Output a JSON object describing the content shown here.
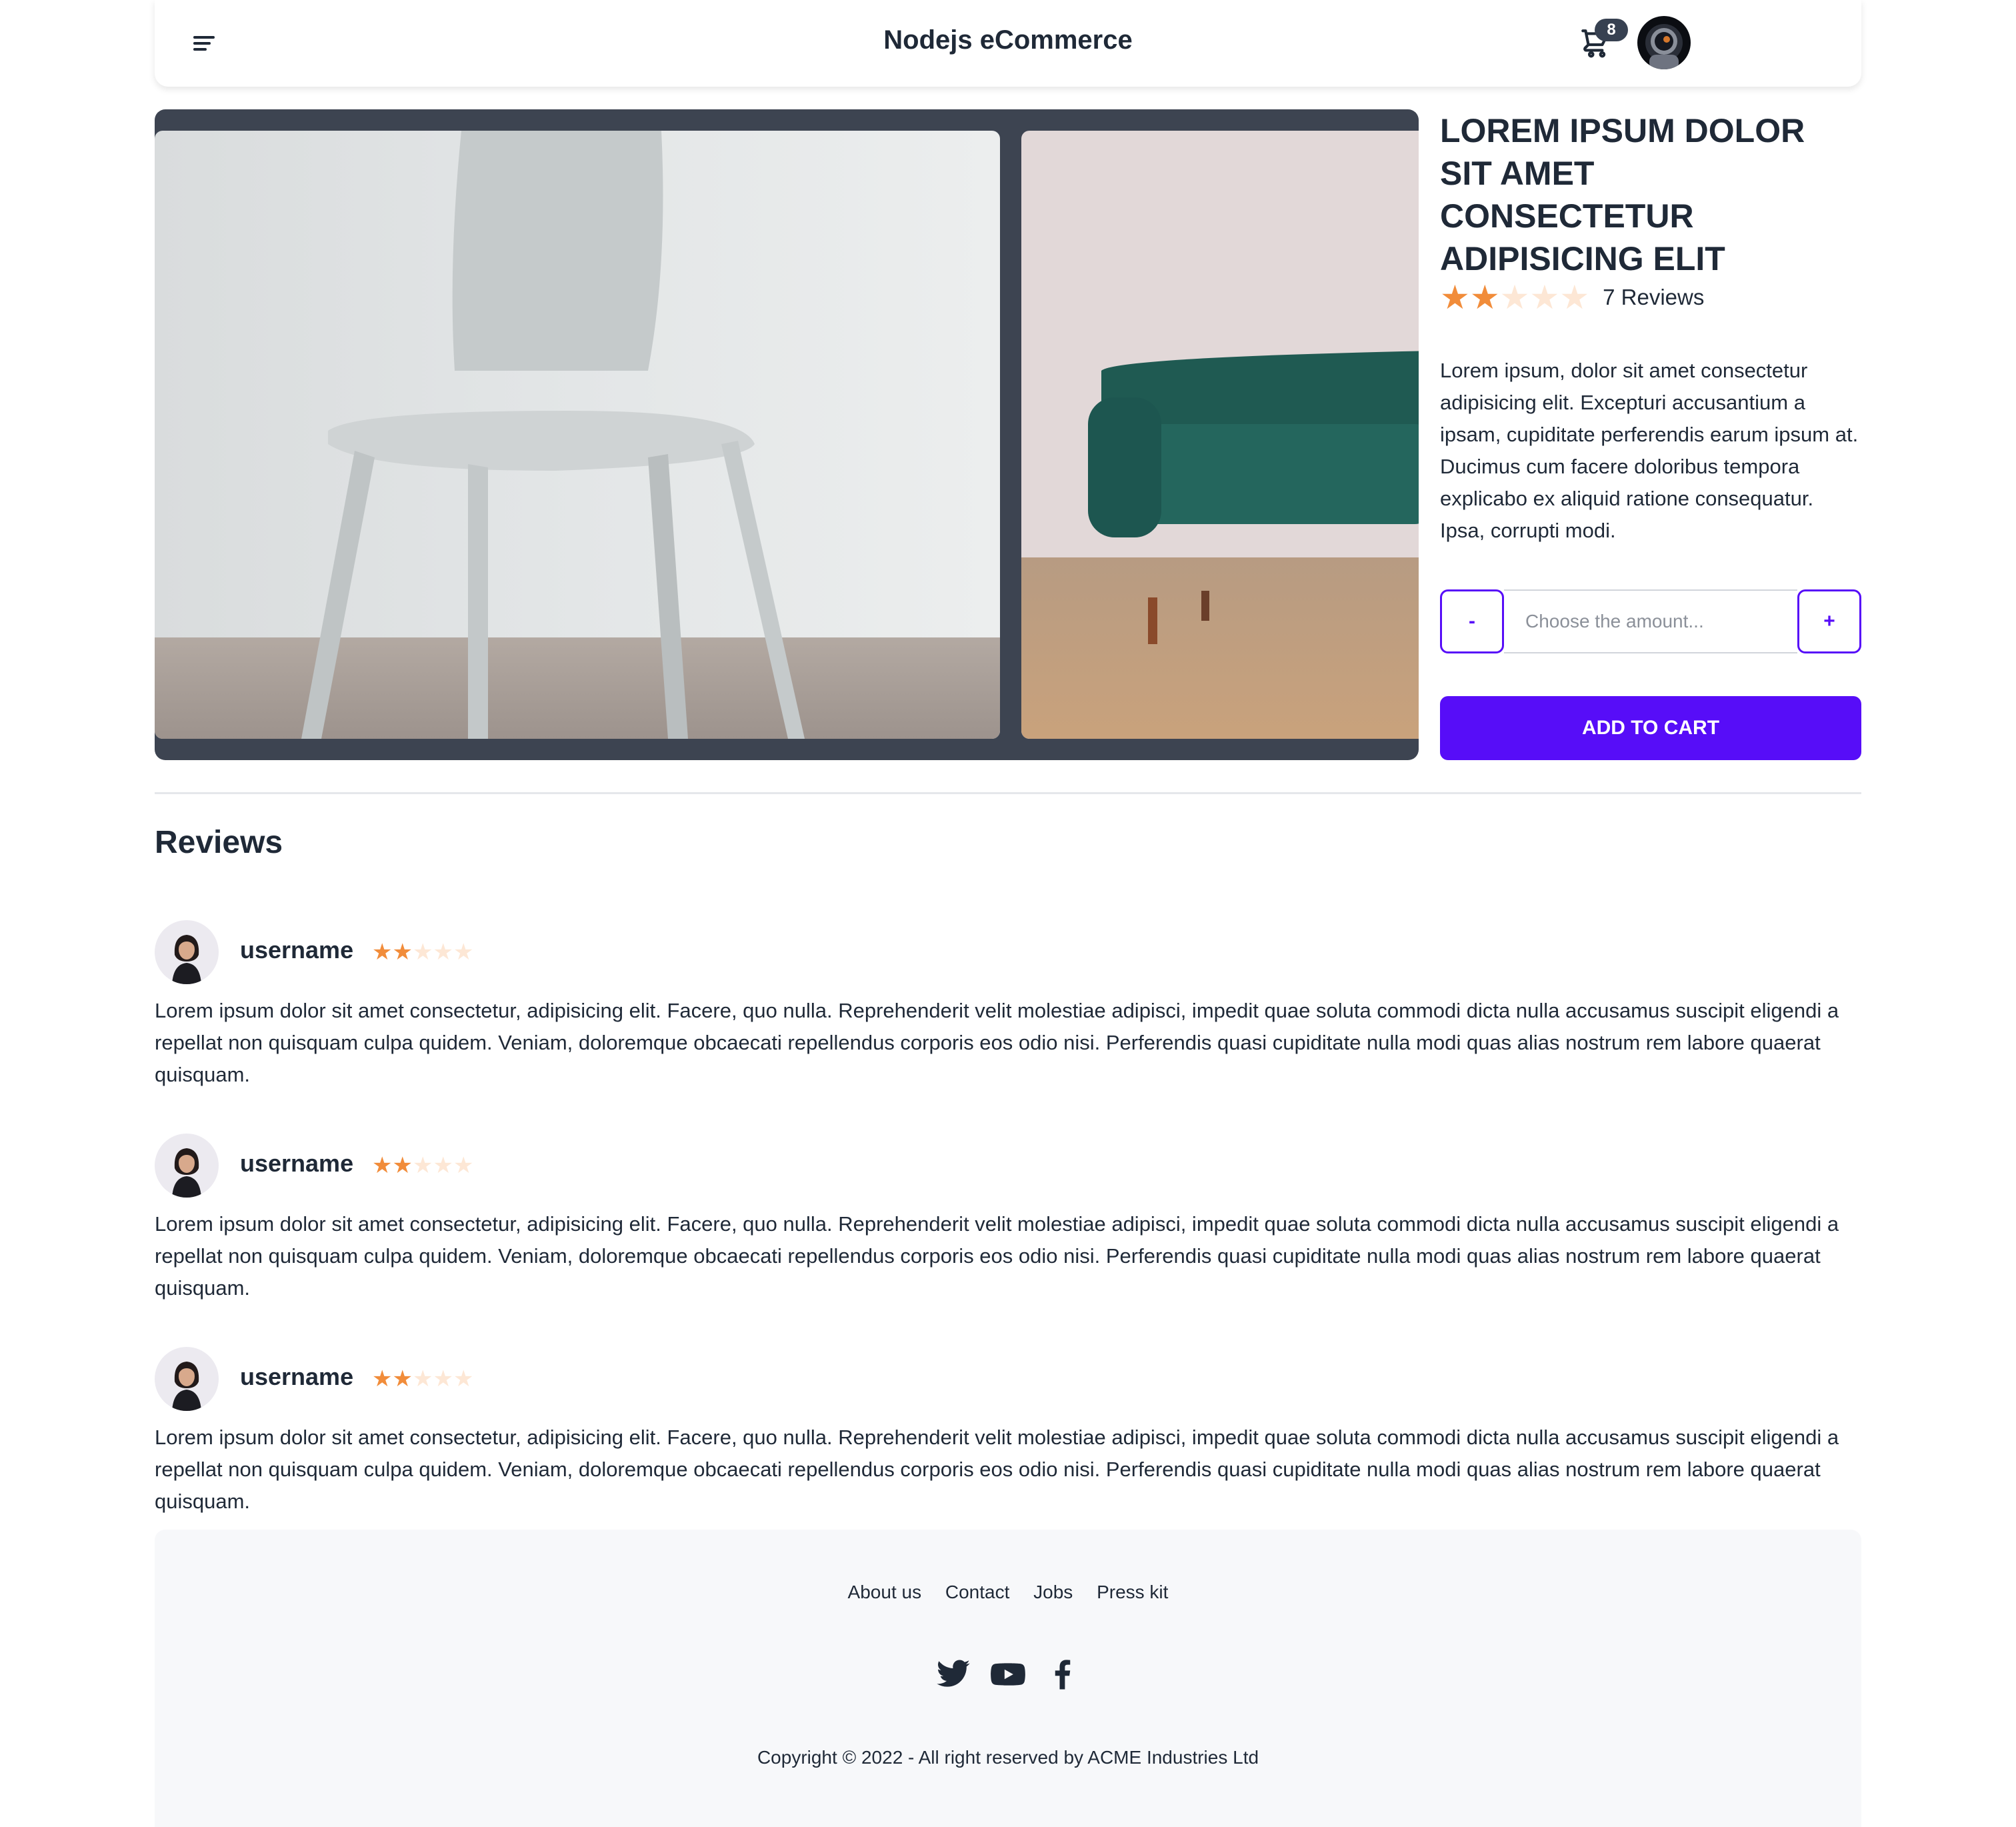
{
  "nav": {
    "title": "Nodejs eCommerce",
    "cart_count": "8"
  },
  "product": {
    "title": "LOREM IPSUM DOLOR SIT AMET CONSECTETUR ADIPISICING ELIT",
    "rating": 2,
    "rating_max": 5,
    "reviews_label": "7 Reviews",
    "description": "Lorem ipsum, dolor sit amet consectetur adipisicing elit. Excepturi accusantium a ipsam, cupiditate perferendis earum ipsum at. Ducimus cum facere doloribus tempora explicabo ex aliquid ratione consequatur. Ipsa, corrupti modi.",
    "qty_minus": "-",
    "qty_plus": "+",
    "qty_placeholder": "Choose the amount...",
    "add_to_cart": "ADD TO CART"
  },
  "reviews": {
    "heading": "Reviews",
    "items": [
      {
        "username": "username",
        "rating": 2,
        "text": "Lorem ipsum dolor sit amet consectetur, adipisicing elit. Facere, quo nulla. Reprehenderit velit molestiae adipisci, impedit quae soluta commodi dicta nulla accusamus suscipit eligendi a repellat non quisquam culpa quidem. Veniam, doloremque obcaecati repellendus corporis eos odio nisi. Perferendis quasi cupiditate nulla modi quas alias nostrum rem labore quaerat quisquam."
      },
      {
        "username": "username",
        "rating": 2,
        "text": "Lorem ipsum dolor sit amet consectetur, adipisicing elit. Facere, quo nulla. Reprehenderit velit molestiae adipisci, impedit quae soluta commodi dicta nulla accusamus suscipit eligendi a repellat non quisquam culpa quidem. Veniam, doloremque obcaecati repellendus corporis eos odio nisi. Perferendis quasi cupiditate nulla modi quas alias nostrum rem labore quaerat quisquam."
      },
      {
        "username": "username",
        "rating": 2,
        "text": "Lorem ipsum dolor sit amet consectetur, adipisicing elit. Facere, quo nulla. Reprehenderit velit molestiae adipisci, impedit quae soluta commodi dicta nulla accusamus suscipit eligendi a repellat non quisquam culpa quidem. Veniam, doloremque obcaecati repellendus corporis eos odio nisi. Perferendis quasi cupiditate nulla modi quas alias nostrum rem labore quaerat quisquam."
      }
    ]
  },
  "footer": {
    "links": [
      "About us",
      "Contact",
      "Jobs",
      "Press kit"
    ],
    "social_icons": [
      "twitter-icon",
      "youtube-icon",
      "facebook-icon"
    ],
    "copyright": "Copyright © 2022 - All right reserved by ACME Industries Ltd"
  },
  "colors": {
    "primary": "#570df8",
    "star_on": "#f18c3a",
    "star_off": "#fde7d5",
    "carousel_bg": "#3d4451",
    "text": "#1f2937"
  },
  "icons": {
    "menu": "menu-icon",
    "cart": "cart-icon",
    "avatar": "astronaut-avatar"
  }
}
